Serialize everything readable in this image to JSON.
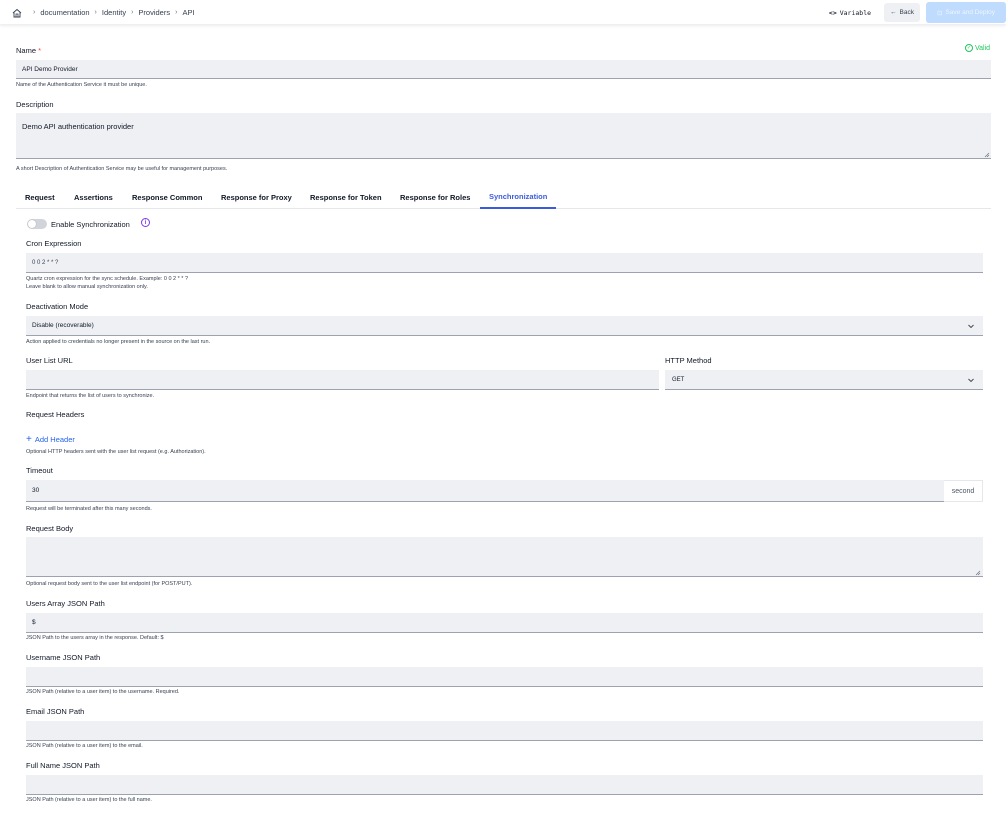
{
  "breadcrumb": [
    "documentation",
    "Identity",
    "Providers",
    "API"
  ],
  "toolbar": {
    "variable_label": "Variable",
    "back_label": "Back",
    "save_label": "Save and Deploy"
  },
  "form": {
    "name_label": "Name",
    "name_required_mark": "*",
    "valid_label": "Valid",
    "name_value": "API Demo Provider",
    "name_hint": "Name of the Authentication Service it must be unique.",
    "description_label": "Description",
    "description_value": "Demo API authentication provider",
    "description_hint": "A short Description of Authentication Service may be useful for management purposes."
  },
  "tabs": [
    {
      "label": "Request",
      "active": false
    },
    {
      "label": "Assertions",
      "active": false
    },
    {
      "label": "Response Common",
      "active": false
    },
    {
      "label": "Response for Proxy",
      "active": false
    },
    {
      "label": "Response for Token",
      "active": false
    },
    {
      "label": "Response for Roles",
      "active": false
    },
    {
      "label": "Synchronization",
      "active": true
    }
  ],
  "sync": {
    "enable_label": "Enable Synchronization",
    "enabled": false,
    "cron_label": "Cron Expression",
    "cron_value": "0 0 2 * * ?",
    "cron_hint_1": "Quartz cron expression for the sync schedule. Example: 0 0 2 * * ?",
    "cron_hint_2": "Leave blank to allow manual synchronization only.",
    "deactivation_label": "Deactivation Mode",
    "deactivation_value": "Disable (recoverable)",
    "deactivation_hint": "Action applied to credentials no longer present in the source on the last run.",
    "user_list_url_label": "User List URL",
    "user_list_url_value": "",
    "user_list_url_hint": "Endpoint that returns the list of users to synchronize.",
    "http_method_label": "HTTP Method",
    "http_method_value": "GET",
    "headers_label": "Request Headers",
    "add_header_label": "Add Header",
    "headers_hint": "Optional HTTP headers sent with the user list request (e.g. Authorization).",
    "timeout_label": "Timeout",
    "timeout_value": "30",
    "timeout_unit": "second",
    "timeout_hint": "Request will be terminated after this many seconds.",
    "body_label": "Request Body",
    "body_value": "",
    "body_hint": "Optional request body sent to the user list endpoint (for POST/PUT).",
    "users_array_label": "Users Array JSON Path",
    "users_array_value": "$",
    "users_array_hint": "JSON Path to the users array in the response. Default: $",
    "username_label": "Username JSON Path",
    "username_value": "",
    "username_hint": "JSON Path (relative to a user item) to the username. Required.",
    "email_label": "Email JSON Path",
    "email_value": "",
    "email_hint": "JSON Path (relative to a user item) to the email.",
    "fullname_label": "Full Name JSON Path",
    "fullname_value": "",
    "fullname_hint": "JSON Path (relative to a user item) to the full name."
  },
  "colors": {
    "accent": "#3b5bdb",
    "valid": "#22c55e",
    "field_bg": "#eef0f4",
    "save_disabled": "#bfdbfe"
  }
}
